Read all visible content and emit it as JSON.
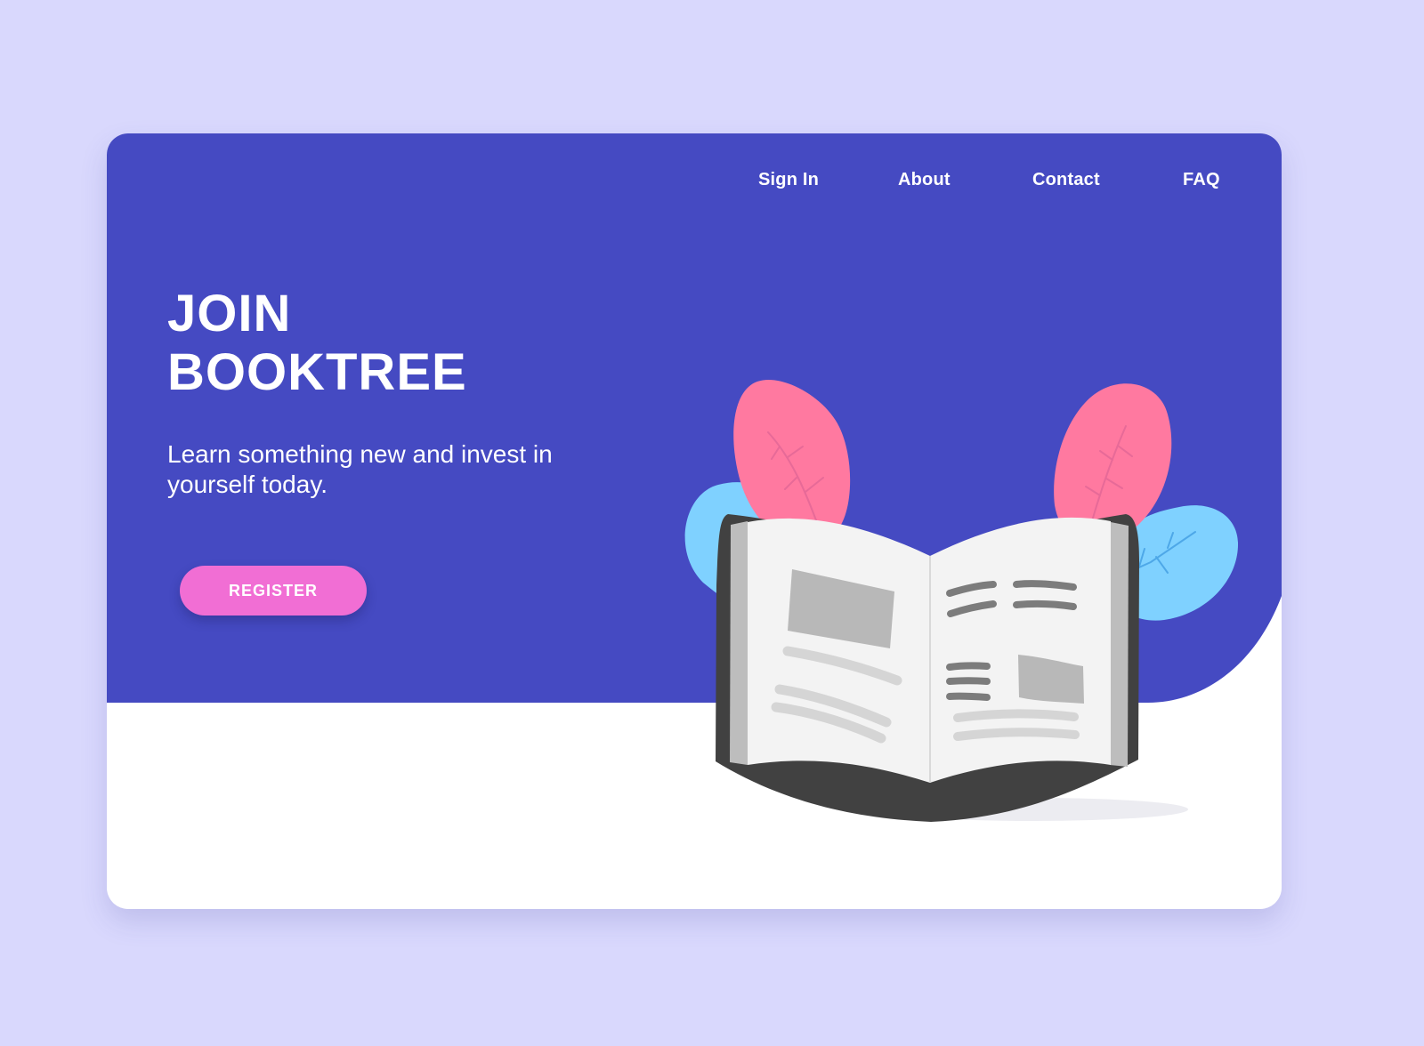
{
  "nav": {
    "items": [
      "Sign In",
      "About",
      "Contact",
      "FAQ"
    ]
  },
  "hero": {
    "title_line1": "JOIN",
    "title_line2": "BOOKTREE",
    "subtitle": "Learn something new and invest in yourself today.",
    "cta_label": "REGISTER"
  },
  "icons": {
    "illustration": "open-book-with-leaves-icon"
  },
  "colors": {
    "page_background": "#d9d8fd",
    "hero_background": "#454ac2",
    "card_background": "#ffffff",
    "cta": "#f16ed4",
    "leaf_pink": "#ff79a0",
    "leaf_blue": "#7fd1ff"
  }
}
